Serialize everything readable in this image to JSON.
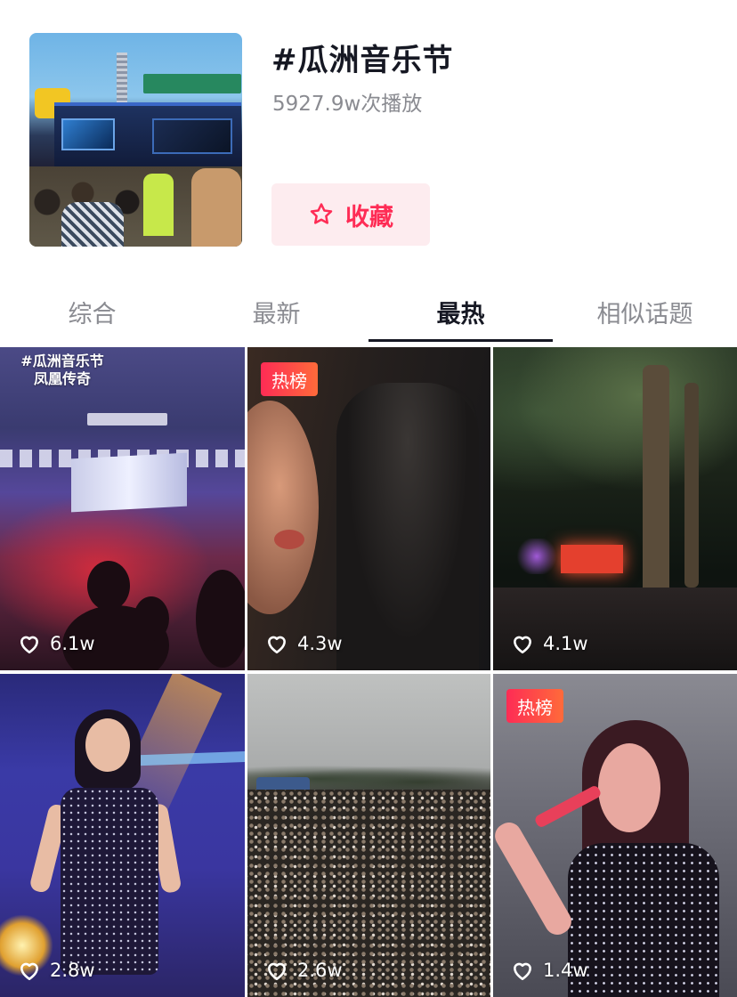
{
  "topic": {
    "title": "#瓜洲音乐节",
    "play_count": "5927.9w次播放",
    "favorite_label": "收藏"
  },
  "tabs": [
    {
      "label": "综合",
      "active": false
    },
    {
      "label": "最新",
      "active": false
    },
    {
      "label": "最热",
      "active": true
    },
    {
      "label": "相似话题",
      "active": false
    }
  ],
  "videos": [
    {
      "caption_line1": "#瓜洲音乐节",
      "caption_line2": "凤凰传奇",
      "badge": "",
      "likes": "6.1w"
    },
    {
      "caption_line1": "",
      "caption_line2": "",
      "badge": "热榜",
      "likes": "4.3w"
    },
    {
      "caption_line1": "",
      "caption_line2": "",
      "badge": "",
      "likes": "4.1w"
    },
    {
      "caption_line1": "",
      "caption_line2": "",
      "badge": "",
      "likes": "2.8w"
    },
    {
      "caption_line1": "",
      "caption_line2": "",
      "badge": "",
      "likes": "2.6w"
    },
    {
      "caption_line1": "",
      "caption_line2": "",
      "badge": "热榜",
      "likes": "1.4w"
    }
  ],
  "icons": {
    "favorite": "star-outline-icon",
    "likes": "heart-outline-icon"
  },
  "colors": {
    "accent": "#fe2c55",
    "favorite_bg": "#fdecef",
    "text_primary": "#161823",
    "text_secondary": "#8a8b91"
  }
}
